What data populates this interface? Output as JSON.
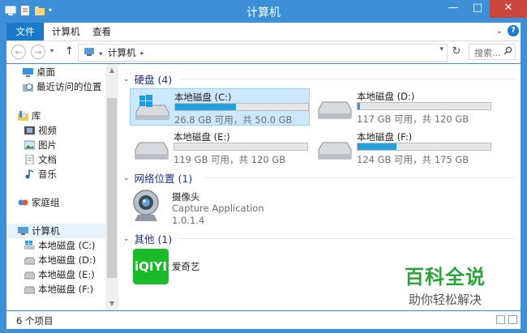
{
  "window": {
    "title": "计算机",
    "controls": {
      "minimize": "—",
      "maximize": "□",
      "close": "✕"
    }
  },
  "ribbon": {
    "file_tab": "文件",
    "tabs": [
      "计算机",
      "查看"
    ]
  },
  "address": {
    "location": "计算机",
    "search_placeholder": "搜索..."
  },
  "nav": {
    "items": [
      {
        "label": "桌面",
        "icon": "desktop-icon"
      },
      {
        "label": "最近访问的位置",
        "icon": "recent-places-icon"
      },
      {
        "label": "库",
        "icon": "library-icon"
      },
      {
        "label": "视频",
        "icon": "videos-icon"
      },
      {
        "label": "图片",
        "icon": "pictures-icon"
      },
      {
        "label": "文档",
        "icon": "documents-icon"
      },
      {
        "label": "音乐",
        "icon": "music-icon"
      },
      {
        "label": "家庭组",
        "icon": "homegroup-icon"
      },
      {
        "label": "计算机",
        "icon": "computer-icon"
      },
      {
        "label": "本地磁盘 (C:)",
        "icon": "drive-icon"
      },
      {
        "label": "本地磁盘 (D:)",
        "icon": "drive-icon"
      },
      {
        "label": "本地磁盘 (E:)",
        "icon": "drive-icon"
      },
      {
        "label": "本地磁盘 (F:)",
        "icon": "drive-icon"
      }
    ]
  },
  "groups": {
    "drives": {
      "title": "硬盘 (4)"
    },
    "network": {
      "title": "网络位置 (1)"
    },
    "other": {
      "title": "其他 (1)"
    }
  },
  "drives": [
    {
      "name": "本地磁盘 (C:)",
      "size": "26.8 GB 可用，共 50.0 GB",
      "used_fraction": 0.46
    },
    {
      "name": "本地磁盘 (D:)",
      "size": "117 GB 可用，共 120 GB",
      "used_fraction": 0.02
    },
    {
      "name": "本地磁盘 (E:)",
      "size": "119 GB 可用，共 120 GB",
      "used_fraction": 0.0
    },
    {
      "name": "本地磁盘 (F:)",
      "size": "124 GB 可用，共 175 GB",
      "used_fraction": 0.29
    }
  ],
  "network_item": {
    "name": "摄像头",
    "subtitle": "Capture Application",
    "version": "1.0.1.4"
  },
  "other_item": {
    "name": "爱奇艺",
    "logo_text": "iQIYI"
  },
  "watermark": {
    "title": "百科全说",
    "subtitle": "助你轻松解决"
  },
  "status": {
    "count": "6 个项目"
  },
  "colors": {
    "accent": "#1979ca",
    "progress": "#26a0da",
    "iqiyi_green": "#19bc28"
  }
}
